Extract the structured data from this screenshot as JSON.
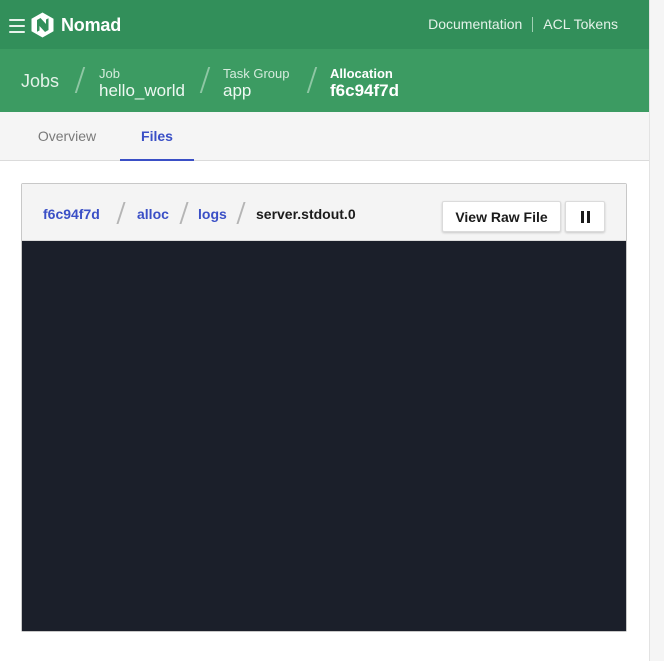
{
  "app": {
    "name": "Nomad",
    "brand_color": "#328f5a"
  },
  "topnav": {
    "links": [
      "Documentation",
      "ACL Tokens"
    ]
  },
  "breadcrumb": {
    "root": "Jobs",
    "items": [
      {
        "label": "Job",
        "value": "hello_world"
      },
      {
        "label": "Task Group",
        "value": "app"
      },
      {
        "label": "Allocation",
        "value": "f6c94f7d"
      }
    ]
  },
  "tabs": [
    {
      "label": "Overview",
      "active": false
    },
    {
      "label": "Files",
      "active": true
    }
  ],
  "file_view": {
    "path": [
      "f6c94f7d",
      "alloc",
      "logs"
    ],
    "current_file": "server.stdout.0",
    "view_raw_label": "View Raw File",
    "pause_icon": "pause-icon",
    "log_background": "#1b1f2a"
  }
}
